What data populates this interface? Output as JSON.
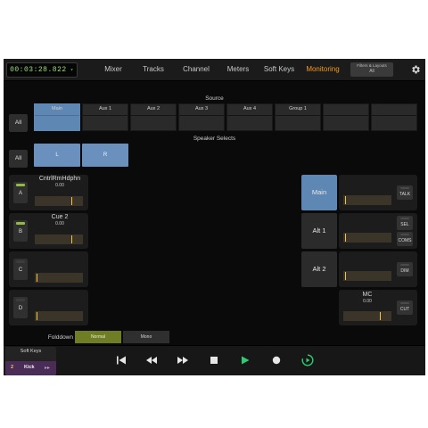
{
  "topbar": {
    "timecode": "00:03:28.822",
    "tabs": [
      "Mixer",
      "Tracks",
      "Channel",
      "Meters",
      "Soft Keys",
      "Monitoring"
    ],
    "active_tab": "Monitoring",
    "filters": {
      "title": "Filters & Layouts",
      "value": "All"
    },
    "settings_icon": "gear-icon"
  },
  "source": {
    "label": "Source",
    "all_label": "All",
    "buttons": [
      "Main",
      "Aux 1",
      "Aux 2",
      "Aux 3",
      "Aux 4",
      "Group 1",
      "",
      ""
    ],
    "selected": "Main"
  },
  "speaker_selects": {
    "label": "Speaker Selects",
    "all_label": "All",
    "buttons": [
      "L",
      "R"
    ]
  },
  "outputs": [
    {
      "letter": "A",
      "name": "CntrlRmHdphn",
      "value": "0.00",
      "active": true,
      "level": 0.75
    },
    {
      "letter": "B",
      "name": "Cue 2",
      "value": "0.00",
      "active": true,
      "level": 0.75
    },
    {
      "letter": "C",
      "name": "",
      "value": "",
      "active": false,
      "level": 0.0
    },
    {
      "letter": "D",
      "name": "",
      "value": "",
      "active": false,
      "level": 0.0
    }
  ],
  "monitor": {
    "buttons": [
      "Main",
      "Alt 1",
      "Alt 2"
    ],
    "selected": "Main",
    "talk": "TALK",
    "sel": "SEL",
    "coms": "COMS",
    "dim": "DIM",
    "cut": "CUT",
    "mc": {
      "name": "MC",
      "value": "0.00",
      "level": 0.75
    }
  },
  "folddown": {
    "label": "Folddown",
    "options": [
      "Normal",
      "Mono"
    ],
    "selected": "Normal"
  },
  "bottom": {
    "soft_keys_label": "Soft Keys",
    "soft_key_number": "2",
    "soft_key_name": "Kick",
    "transport_icons": [
      "rewind-to-start-icon",
      "rewind-icon",
      "fast-forward-icon",
      "stop-icon",
      "play-icon",
      "record-icon",
      "loop-icon"
    ]
  },
  "colors": {
    "accent": "#f39a1e",
    "selected_blue": "#5f87b4",
    "timecode_green": "#9adf7a",
    "play_green": "#2ecc71",
    "fader_yellow": "#f3c24a"
  }
}
